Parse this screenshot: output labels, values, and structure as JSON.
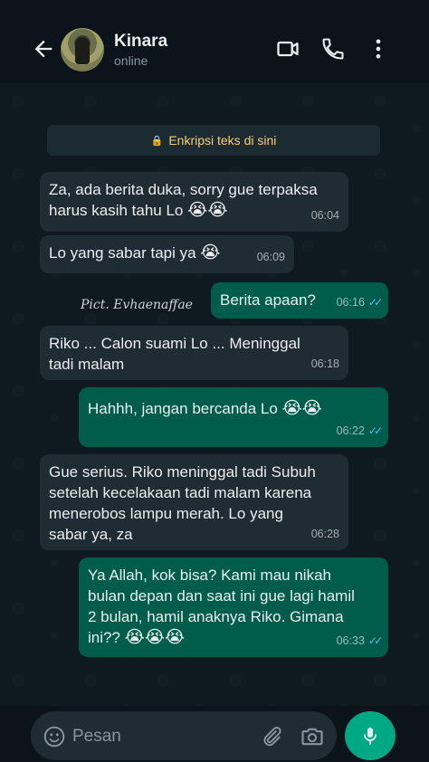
{
  "header": {
    "contact_name": "Kinara",
    "status": "online",
    "icons": [
      "back-arrow-icon",
      "video-call-icon",
      "voice-call-icon",
      "more-options-icon"
    ]
  },
  "encryption_notice": "Enkripsi teks di sini",
  "watermark": "Pict. Evhaenaffae",
  "messages": [
    {
      "dir": "in",
      "text_l1": "Za, ada berita duka, sorry gue terpaksa",
      "text_l2": "harus kasih tahu Lo",
      "emoji": "😭😭",
      "time": "06:04"
    },
    {
      "dir": "in",
      "text": "Lo yang sabar tapi ya",
      "emoji": "😭",
      "time": "06:09"
    },
    {
      "dir": "out",
      "text": "Berita apaan?",
      "time": "06:16"
    },
    {
      "dir": "in",
      "text_l1": "Riko ... Calon suami Lo ... Meninggal",
      "text_l2": "tadi malam",
      "time": "06:18"
    },
    {
      "dir": "out",
      "text": "Hahhh, jangan bercanda Lo",
      "emoji": "😭😭",
      "time": "06:22"
    },
    {
      "dir": "in",
      "text_l1": "Gue serius. Riko meninggal tadi Subuh",
      "text_l2": "setelah kecelakaan tadi malam karena",
      "text_l3": "menerobos lampu merah. Lo yang",
      "text_l4": "sabar ya, za",
      "time": "06:28"
    },
    {
      "dir": "out",
      "text_l1": "Ya Allah, kok bisa? Kami mau nikah",
      "text_l2": "bulan depan dan saat ini gue lagi hamil",
      "text_l3": "2 bulan, hamil anaknya Riko. Gimana",
      "text_l4": "ini??",
      "emoji": "😭😭😭",
      "time": "06:33"
    }
  ],
  "input": {
    "placeholder": "Pesan",
    "icons": [
      "emoji-icon",
      "attach-icon",
      "camera-icon",
      "mic-icon"
    ]
  },
  "colors": {
    "background": "#0b141a",
    "incoming_bubble": "#202c33",
    "outgoing_bubble": "#005c4b",
    "accent": "#00a884",
    "read_ticks": "#53bdeb",
    "encryption_text": "#f7cd73"
  }
}
